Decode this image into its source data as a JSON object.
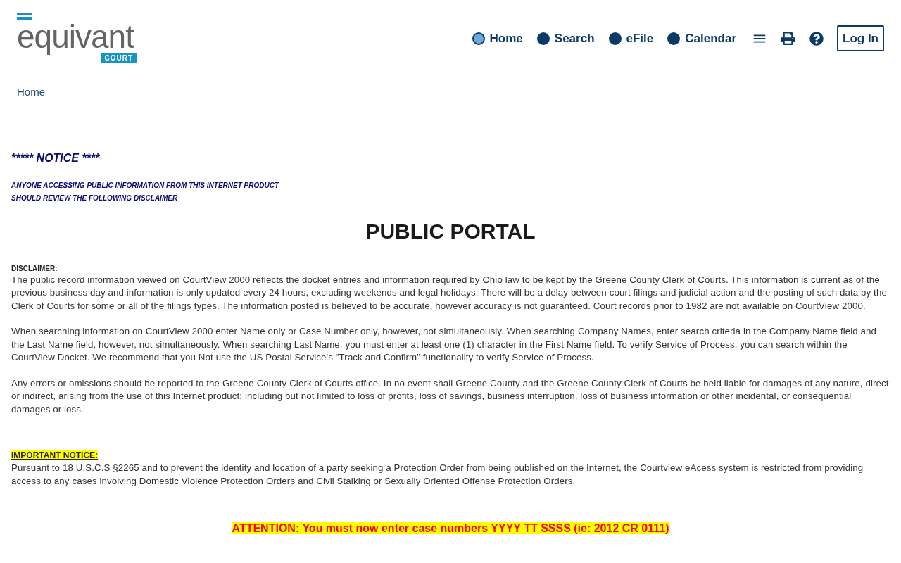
{
  "header": {
    "logo": {
      "wordmark": "equivant",
      "badge": "COURT"
    },
    "nav": [
      {
        "label": "Home",
        "selected": true
      },
      {
        "label": "Search",
        "selected": false
      },
      {
        "label": "eFile",
        "selected": false
      },
      {
        "label": "Calendar",
        "selected": false
      }
    ],
    "login_button": "Log In"
  },
  "breadcrumb": [
    "Home"
  ],
  "notice": {
    "heading": "***** NOTICE ****",
    "lines": [
      "ANYONE ACCESSING PUBLIC INFORMATION FROM THIS INTERNET PRODUCT",
      "SHOULD REVIEW THE FOLLOWING DISCLAIMER"
    ]
  },
  "title": "PUBLIC PORTAL",
  "disclaimer": {
    "label": "DISCLAIMER:",
    "paragraphs": [
      "The public record information viewed on CourtView 2000 reflects the docket entries and information required by Ohio law to be kept by the Greene County Clerk of Courts. This information is current as of the previous business day and information is only updated every 24 hours, excluding weekends and legal holidays. There will be a delay between court filings and judicial action and the posting of such data by the Clerk of Courts for some or all of the filings types. The information posted is believed to be accurate, however accuracy is not guaranteed. Court records prior to 1982 are not available on CourtView 2000.",
      "When searching information on CourtView 2000 enter Name only or Case Number only, however, not simultaneously. When searching Company Names, enter search criteria in the Company Name field and the Last Name field, however, not simultaneously. When searching Last Name, you must enter at least one (1) character in the First Name field. To verify Service of Process, you can search within the CourtView Docket. We recommend that you Not use the US Postal Service's \"Track and Confirm\" functionality to verify Service of Process.",
      "Any errors or omissions should be reported to the Greene County Clerk of Courts office. In no event shall Greene County and the Greene County Clerk of Courts be held liable for damages of any nature, direct or indirect, arising from the use of this Internet product; including but not limited to loss of profits, loss of savings, business interruption, loss of business information or other incidental, or consequential damages or loss."
    ]
  },
  "important_notice": {
    "label": "IMPORTANT NOTICE:",
    "text": "Pursuant to 18 U.S.C.S §2265 and to prevent the identity and location of a party seeking a Protection Order from being published on the Internet, the Courtview eAcess system is restricted from providing access to any cases involving Domestic Violence Protection Orders and Civil Stalking or Sexually Oriented Offense Protection Orders."
  },
  "attention": "ATTENTION: You must now enter case numbers YYYY TT SSSS (ie: 2012 CR 0111)"
}
